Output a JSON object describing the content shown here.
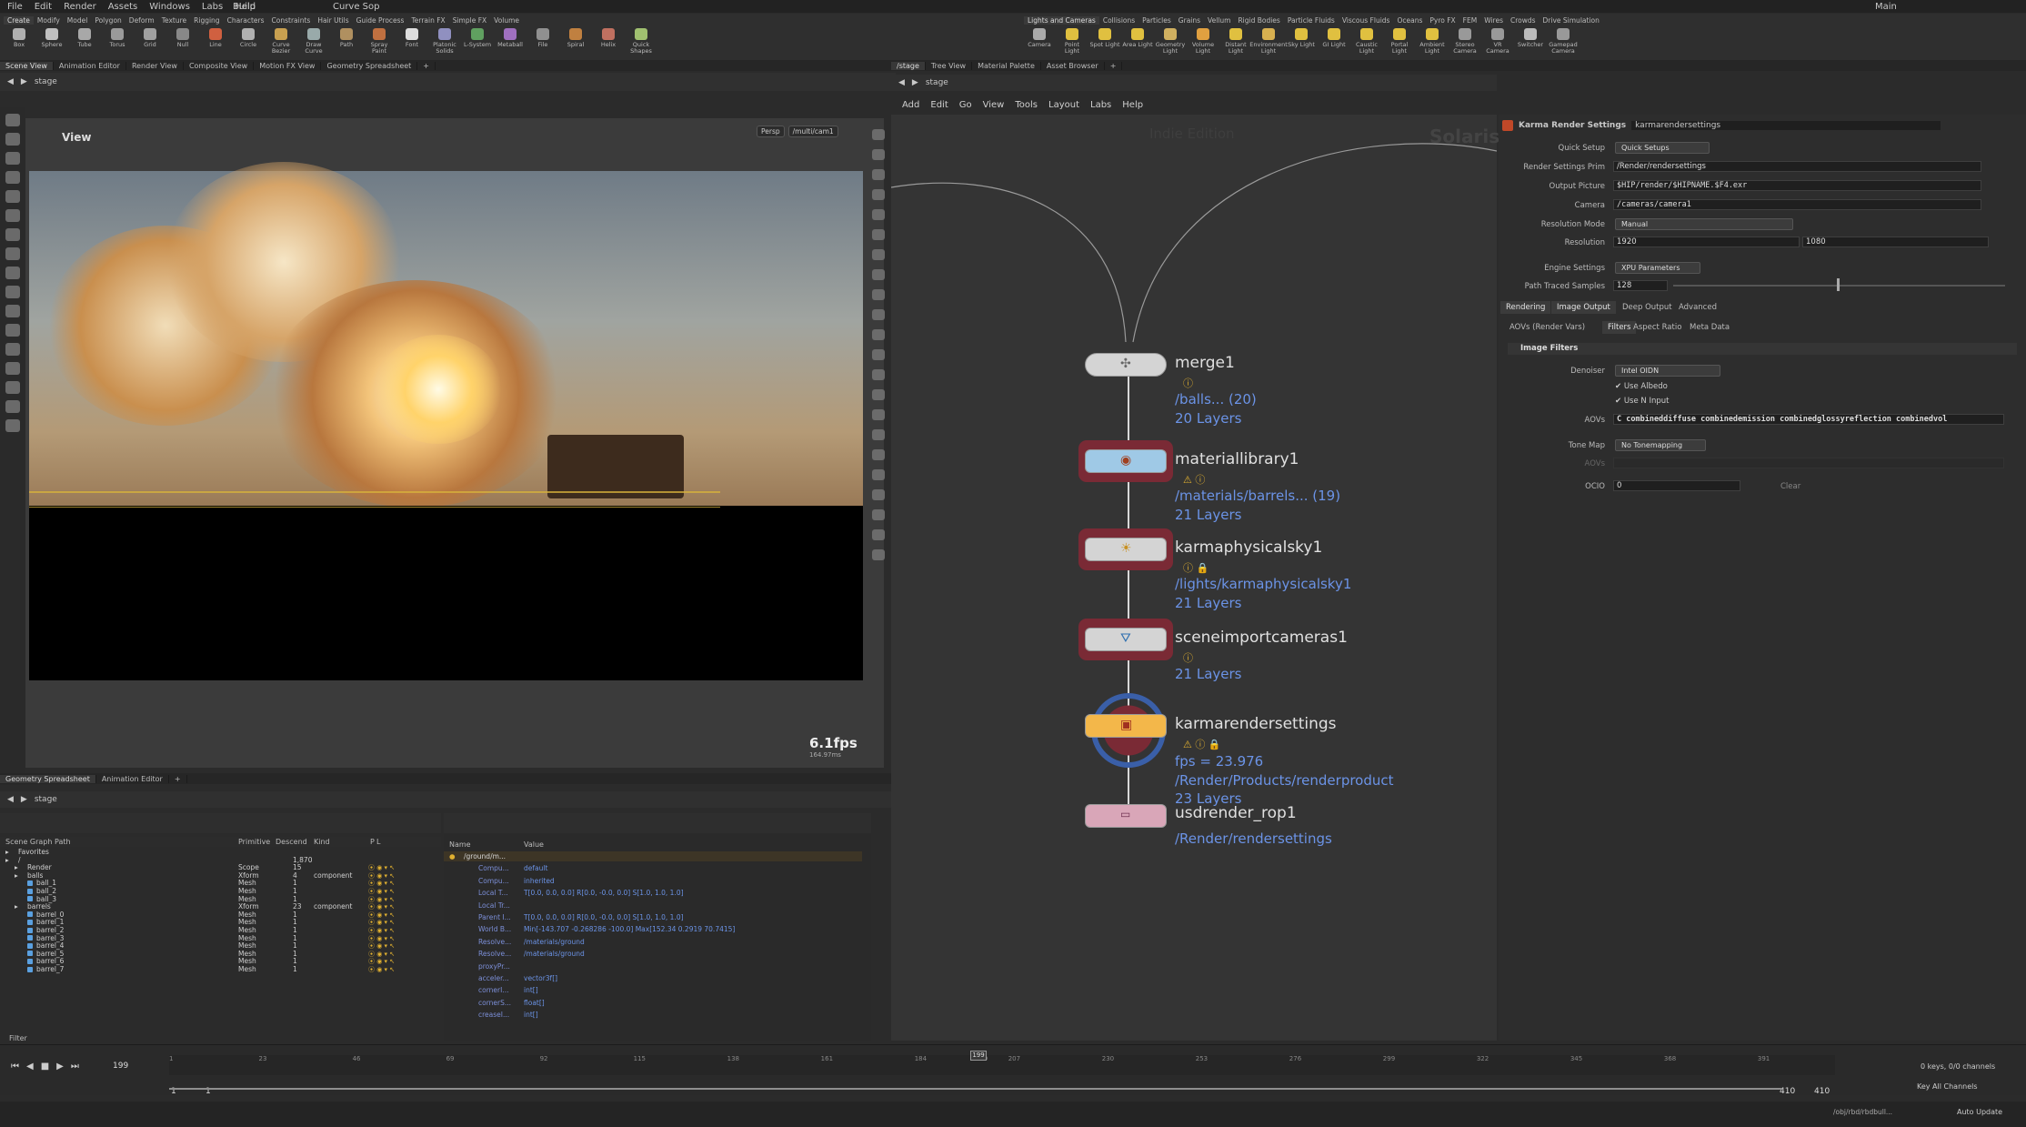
{
  "menubar": {
    "items": [
      "File",
      "Edit",
      "Render",
      "Assets",
      "Windows",
      "Labs",
      "Help"
    ],
    "desktop": "Build",
    "pane_context": "Curve Sop",
    "workspace": "Main"
  },
  "shelf_left": {
    "tabs": [
      "Create",
      "Modify",
      "Model",
      "Polygon",
      "Deform",
      "Texture",
      "Rigging",
      "Characters",
      "Constraints",
      "Hair Utils",
      "Guide Process",
      "Terrain FX",
      "Simple FX",
      "Volume"
    ],
    "tools": [
      "Box",
      "Sphere",
      "Tube",
      "Torus",
      "Grid",
      "Null",
      "Line",
      "Circle",
      "Curve Bezier",
      "Draw Curve",
      "Path",
      "Spray Paint",
      "Font",
      "Platonic Solids",
      "L-System",
      "Metaball",
      "File",
      "Spiral",
      "Helix",
      "Quick Shapes"
    ]
  },
  "shelf_right": {
    "tabs": [
      "Lights and Cameras",
      "Collisions",
      "Particles",
      "Grains",
      "Vellum",
      "Rigid Bodies",
      "Particle Fluids",
      "Viscous Fluids",
      "Oceans",
      "Pyro FX",
      "FEM",
      "Wires",
      "Crowds",
      "Drive Simulation"
    ],
    "tools": [
      "Camera",
      "Point Light",
      "Spot Light",
      "Area Light",
      "Geometry Light",
      "Volume Light",
      "Distant Light",
      "Environment Light",
      "Sky Light",
      "GI Light",
      "Caustic Light",
      "Portal Light",
      "Ambient Light",
      "Stereo Camera",
      "VR Camera",
      "Switcher",
      "Gamepad Camera"
    ]
  },
  "left_tabs": [
    "Scene View",
    "Animation Editor",
    "Render View",
    "Composite View",
    "Motion FX View",
    "Geometry Spreadsheet"
  ],
  "viewport": {
    "path": "stage",
    "title": "View",
    "camera_menu": "Persp",
    "camera_path": "/multi/cam1",
    "fps": "6.1fps",
    "fps_sub": "164.97ms"
  },
  "bottom_tabs": [
    "Geometry Spreadsheet",
    "Animation Editor"
  ],
  "bottom_path": "stage",
  "scene_graph": {
    "headers": [
      "Scene Graph Path",
      "Primitive",
      "Descend",
      "Kind",
      "P",
      "L",
      "Name",
      "Value"
    ],
    "rows": [
      {
        "name": "Favorites",
        "prim": "",
        "desc": "",
        "kind": "",
        "depth": 0
      },
      {
        "name": "/",
        "prim": "",
        "desc": "1,870",
        "kind": "",
        "depth": 0
      },
      {
        "name": "Render",
        "prim": "Scope",
        "desc": "15",
        "kind": "",
        "depth": 1
      },
      {
        "name": "balls",
        "prim": "Xform",
        "desc": "4",
        "kind": "component",
        "depth": 1
      },
      {
        "name": "ball_1",
        "prim": "Mesh",
        "desc": "1",
        "kind": "",
        "depth": 2
      },
      {
        "name": "ball_2",
        "prim": "Mesh",
        "desc": "1",
        "kind": "",
        "depth": 2
      },
      {
        "name": "ball_3",
        "prim": "Mesh",
        "desc": "1",
        "kind": "",
        "depth": 2
      },
      {
        "name": "barrels",
        "prim": "Xform",
        "desc": "23",
        "kind": "component",
        "depth": 1
      },
      {
        "name": "barrel_0",
        "prim": "Mesh",
        "desc": "1",
        "kind": "",
        "depth": 2
      },
      {
        "name": "barrel_1",
        "prim": "Mesh",
        "desc": "1",
        "kind": "",
        "depth": 2
      },
      {
        "name": "barrel_2",
        "prim": "Mesh",
        "desc": "1",
        "kind": "",
        "depth": 2
      },
      {
        "name": "barrel_3",
        "prim": "Mesh",
        "desc": "1",
        "kind": "",
        "depth": 2
      },
      {
        "name": "barrel_4",
        "prim": "Mesh",
        "desc": "1",
        "kind": "",
        "depth": 2
      },
      {
        "name": "barrel_5",
        "prim": "Mesh",
        "desc": "1",
        "kind": "",
        "depth": 2
      },
      {
        "name": "barrel_6",
        "prim": "Mesh",
        "desc": "1",
        "kind": "",
        "depth": 2
      },
      {
        "name": "barrel_7",
        "prim": "Mesh",
        "desc": "1",
        "kind": "",
        "depth": 2
      }
    ],
    "filter": "Filter"
  },
  "properties": {
    "head_path": "/ground/m...",
    "rows": [
      {
        "k": "Compu...",
        "v": "default"
      },
      {
        "k": "Compu...",
        "v": "inherited"
      },
      {
        "k": "Local T...",
        "v": "T[0.0, 0.0, 0.0] R[0.0, -0.0, 0.0] S[1.0, 1.0, 1.0]"
      },
      {
        "k": "Local Tr...",
        "v": ""
      },
      {
        "k": "Parent I...",
        "v": "T[0.0, 0.0, 0.0] R[0.0, -0.0, 0.0] S[1.0, 1.0, 1.0]"
      },
      {
        "k": "World B...",
        "v": "Min[-143.707 -0.268286 -100.0] Max[152.34 0.2919 70.7415]"
      },
      {
        "k": "Resolve...",
        "v": "/materials/ground"
      },
      {
        "k": "Resolve...",
        "v": "/materials/ground"
      },
      {
        "k": "proxyPr...",
        "v": ""
      },
      {
        "k": "acceler...",
        "v": "vector3f[]"
      },
      {
        "k": "cornerI...",
        "v": "int[]"
      },
      {
        "k": "cornerS...",
        "v": "float[]"
      },
      {
        "k": "creaseI...",
        "v": "int[]"
      }
    ]
  },
  "timeline": {
    "frame": "199",
    "ticks": [
      "1",
      "23",
      "46",
      "69",
      "92",
      "115",
      "138",
      "161",
      "184",
      "199",
      "207",
      "230",
      "253",
      "276",
      "299",
      "322",
      "345",
      "368",
      "391"
    ],
    "start": "1",
    "start2": "1",
    "end": "410",
    "end2": "410",
    "keys_info": "0 keys, 0/0 channels",
    "key_all": "Key All Channels",
    "path": "/obj/rbd/rbdbull...",
    "update": "Auto Update"
  },
  "node_tabs": [
    "/stage",
    "Tree View",
    "Material Palette",
    "Asset Browser"
  ],
  "node_path": "stage",
  "node_menu": [
    "Add",
    "Edit",
    "Go",
    "View",
    "Tools",
    "Layout",
    "Labs",
    "Help"
  ],
  "network": {
    "edition": "Indie Edition",
    "context": "Solaris",
    "nodes": [
      {
        "name": "merge1",
        "sub1": "/balls... (20)",
        "sub2": "20 Layers"
      },
      {
        "name": "materiallibrary1",
        "sub1": "/materials/barrels... (19)",
        "sub2": "21 Layers"
      },
      {
        "name": "karmaphysicalsky1",
        "sub1": "/lights/karmaphysicalsky1",
        "sub2": "21 Layers"
      },
      {
        "name": "sceneimportcameras1",
        "sub1": "",
        "sub2": "21 Layers"
      },
      {
        "name": "karmarendersettings",
        "sub1": "fps = 23.976",
        "sub2": "/Render/Products/renderproduct",
        "sub3": "23 Layers"
      },
      {
        "name": "usdrender_rop1",
        "sub1": "/Render/rendersettings"
      }
    ]
  },
  "params": {
    "node_type": "Karma Render Settings",
    "node_name": "karmarendersettings",
    "quick_setup_label": "Quick Setup",
    "quick_setup": "Quick Setups",
    "render_prim_label": "Render Settings Prim",
    "render_prim": "/Render/rendersettings",
    "output_label": "Output Picture",
    "output": "$HIP/render/$HIPNAME.$F4.exr",
    "camera_label": "Camera",
    "camera": "/cameras/camera1",
    "res_mode_label": "Resolution Mode",
    "res_mode": "Manual",
    "res_label": "Resolution",
    "res_x": "1920",
    "res_y": "1080",
    "engine_label": "Engine Settings",
    "engine": "XPU Parameters",
    "samples_label": "Path Traced Samples",
    "samples": "128",
    "tabs": [
      "Rendering",
      "Image Output",
      "Deep Output",
      "Advanced"
    ],
    "subtabs": [
      "AOVs (Render Vars)",
      "Filters",
      "Aspect Ratio",
      "Meta Data"
    ],
    "section": "Image Filters",
    "denoiser_label": "Denoiser",
    "denoiser": "Intel OIDN",
    "use_albedo": "Use Albedo",
    "use_n": "Use N Input",
    "aovs_label": "AOVs",
    "aovs": "C combineddiffuse combinedemission combinedglossyreflection combinedvol",
    "tonemap_label": "Tone Map",
    "tonemap": "No Tonemapping",
    "aovs2_label": "AOVs",
    "ocio_label": "OCIO",
    "ocio": "0",
    "clear": "Clear"
  }
}
